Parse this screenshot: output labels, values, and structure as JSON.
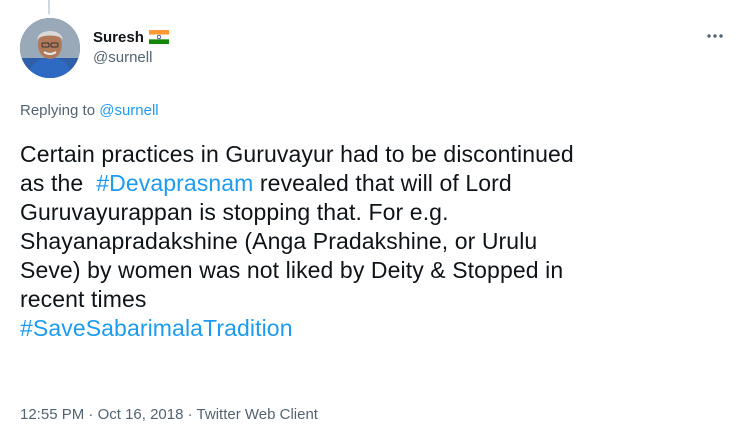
{
  "author": {
    "display_name": "Suresh",
    "handle": "@surnell",
    "flag_icon": "india-flag-icon"
  },
  "reply": {
    "prefix": "Replying to ",
    "to_handle": "@surnell"
  },
  "tweet": {
    "line1": "Certain practices in Guruvayur had to be discontinued",
    "line2_pre": "as the  ",
    "line2_tag": "#Devaprasnam",
    "line2_post": " revealed that will of Lord",
    "line3": "Guruvayurappan is stopping that. For e.g.",
    "line4": "Shayanapradakshine (Anga Pradakshine, or Urulu",
    "line5": "Seve) by women was not liked by Deity & Stopped in",
    "line6": "recent times",
    "line7_tag": "#SaveSabarimalaTradition"
  },
  "meta": {
    "time": "12:55 PM",
    "sep1": " · ",
    "date": "Oct 16, 2018",
    "sep2": " · ",
    "client": "Twitter Web Client"
  },
  "colors": {
    "link": "#1d9bf0",
    "secondary_text": "#536471",
    "primary_text": "#0f1419"
  },
  "icons": {
    "more": "more-options-icon"
  }
}
